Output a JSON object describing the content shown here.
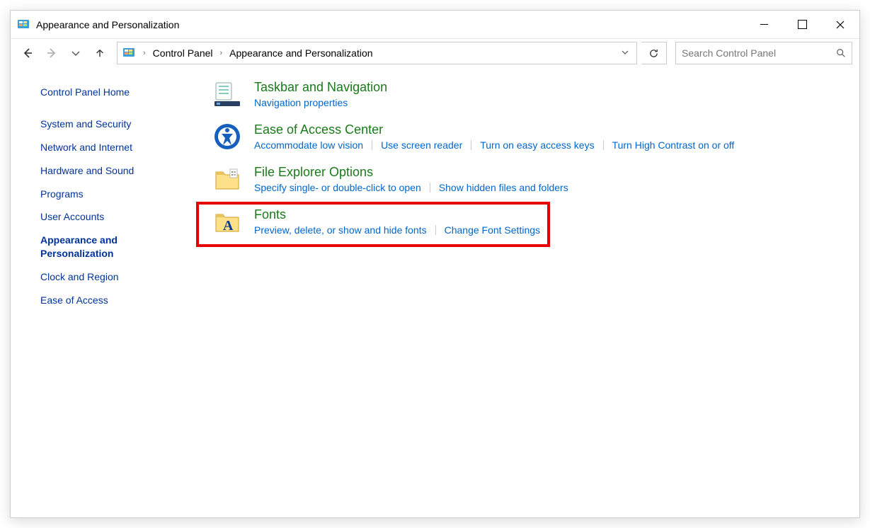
{
  "window": {
    "title": "Appearance and Personalization"
  },
  "breadcrumbs": {
    "root": "Control Panel",
    "current": "Appearance and Personalization"
  },
  "search": {
    "placeholder": "Search Control Panel"
  },
  "sidebar": {
    "home": "Control Panel Home",
    "items": [
      "System and Security",
      "Network and Internet",
      "Hardware and Sound",
      "Programs",
      "User Accounts",
      "Appearance and Personalization",
      "Clock and Region",
      "Ease of Access"
    ]
  },
  "categories": [
    {
      "title": "Taskbar and Navigation",
      "links": [
        "Navigation properties"
      ]
    },
    {
      "title": "Ease of Access Center",
      "links": [
        "Accommodate low vision",
        "Use screen reader",
        "Turn on easy access keys",
        "Turn High Contrast on or off"
      ]
    },
    {
      "title": "File Explorer Options",
      "links": [
        "Specify single- or double-click to open",
        "Show hidden files and folders"
      ]
    },
    {
      "title": "Fonts",
      "links": [
        "Preview, delete, or show and hide fonts",
        "Change Font Settings"
      ]
    }
  ]
}
